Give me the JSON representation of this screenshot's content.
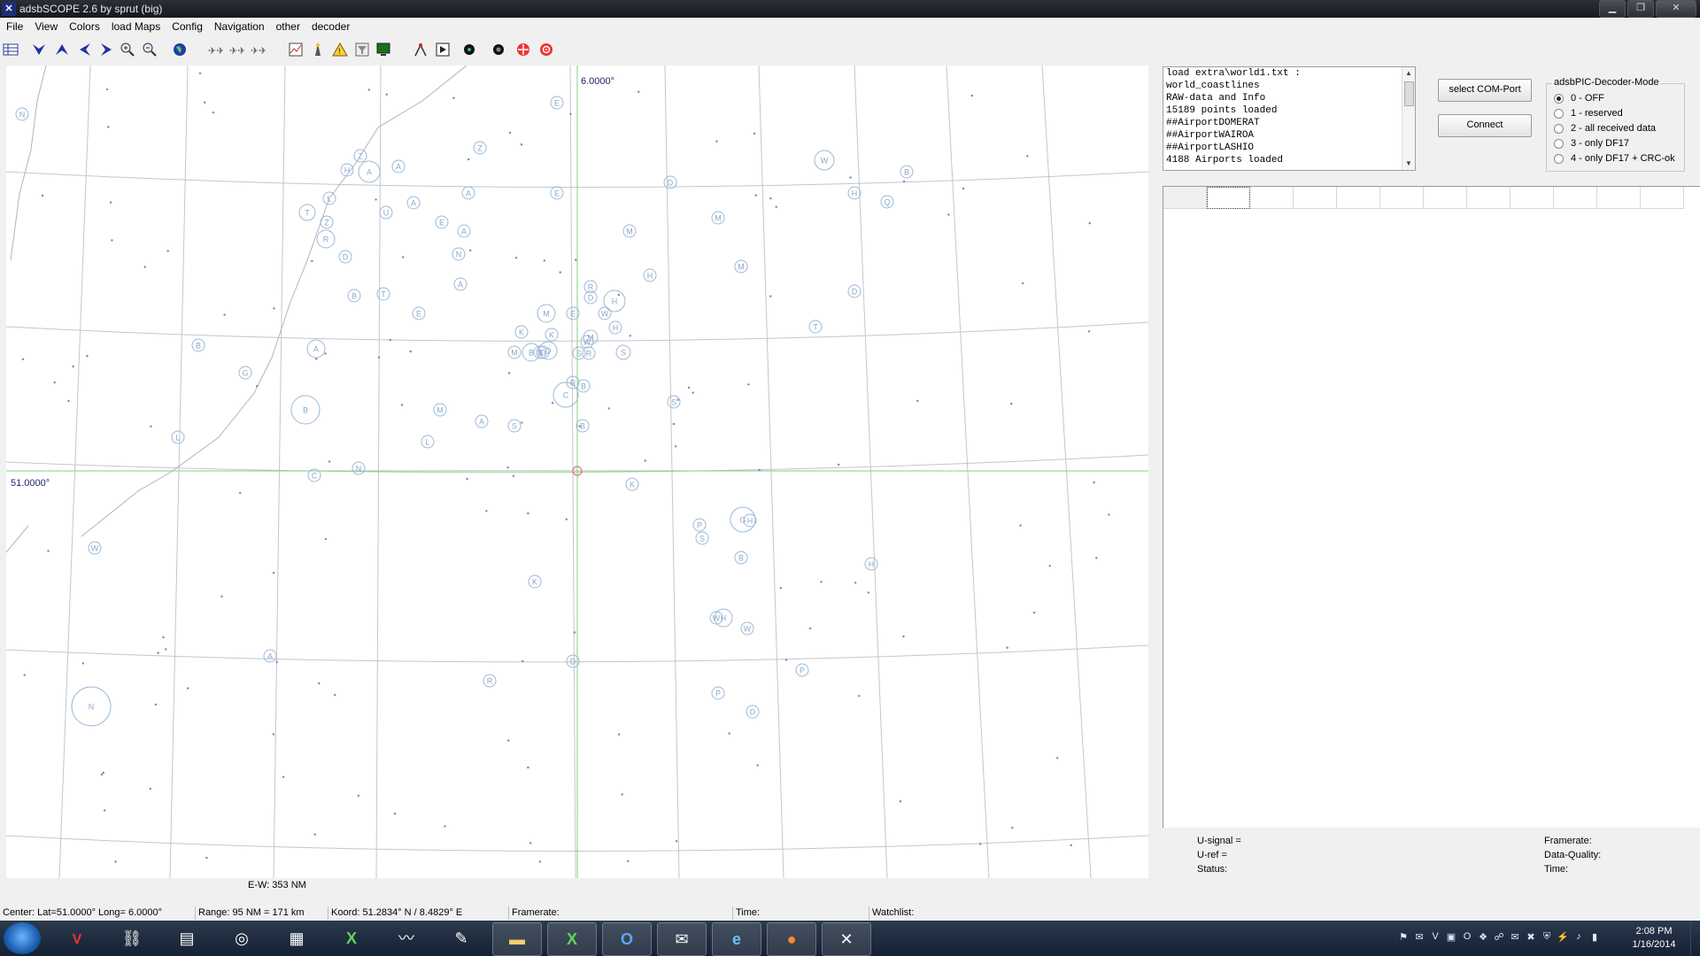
{
  "window": {
    "title": "adsbSCOPE 2.6 by sprut  (big)"
  },
  "menu": [
    "File",
    "View",
    "Colors",
    "load Maps",
    "Config",
    "Navigation",
    "other",
    "decoder"
  ],
  "toolbar_icons": [
    "table-icon",
    "arrow-down-icon",
    "arrow-up-icon",
    "arrow-left-icon",
    "arrow-right-icon",
    "zoom-in-icon",
    "zoom-out-icon",
    "globe-icon",
    "planes1-icon",
    "planes2-icon",
    "planes3-icon",
    "chart-icon",
    "tower-icon",
    "warning-icon",
    "filter-icon",
    "monitor-icon",
    "antenna-icon",
    "play-icon",
    "black-dot-icon",
    "record-icon",
    "crosshair-icon",
    "target-icon"
  ],
  "map": {
    "lon_label": "6.0000°",
    "lat_label": "51.0000°",
    "ew_label": "E-W: 353 NM",
    "airports": [
      "N",
      "Z",
      "H",
      "A",
      "A",
      "L",
      "T",
      "Z",
      "R",
      "U",
      "A",
      "E",
      "D",
      "B",
      "T",
      "E",
      "A",
      "B",
      "G",
      "B",
      "L",
      "C",
      "N",
      "A",
      "M",
      "L",
      "A",
      "E",
      "E",
      "Z",
      "A",
      "A",
      "N",
      "S",
      "M",
      "D",
      "B",
      "O",
      "N",
      "K",
      "M",
      "M",
      "E",
      "R",
      "H",
      "D",
      "W",
      "H",
      "K",
      "W",
      "R",
      "S",
      "C",
      "B",
      "B",
      "S",
      "K",
      "D",
      "M",
      "M",
      "W",
      "B",
      "H",
      "Q",
      "D",
      "T",
      "H",
      "S",
      "M",
      "R",
      "P",
      "G",
      "H",
      "S",
      "B",
      "K",
      "W",
      "W",
      "H",
      "D",
      "R",
      "A",
      "W",
      "P",
      "H",
      "P",
      "D"
    ]
  },
  "log_lines": [
    "load extra\\world1.txt :",
    "world_coastlines",
    "RAW-data and Info",
    "15189 points loaded",
    "##AirportDOMERAT",
    "##AirportWAIROA",
    "##AirportLASHIO",
    "4188 Airports loaded"
  ],
  "buttons": {
    "select_com": "select COM-Port",
    "connect": "Connect"
  },
  "decoder_mode": {
    "legend": "adsbPIC-Decoder-Mode",
    "options": [
      "0 - OFF",
      "1 - reserved",
      "2 - all received data",
      "3 - only DF17",
      "4 - only DF17 + CRC-ok"
    ],
    "selected": "0 - OFF"
  },
  "signal_panel": {
    "u_signal": "U-signal =",
    "u_ref": "U-ref =",
    "status": "Status:",
    "framerate": "Framerate:",
    "data_quality": "Data-Quality:",
    "time": "Time:"
  },
  "statusbar": {
    "center": "Center: Lat=51.0000° Long= 6.0000°",
    "range": "Range: 95 NM = 171 km",
    "koord": "Koord: 51.2834° N / 8.4829° E",
    "framerate": "Framerate:",
    "time": "Time:",
    "watchlist": "Watchlist:"
  },
  "taskbar": {
    "apps": [
      "vc-icon",
      "network-icon",
      "notepad-icon",
      "swirl-icon",
      "calculator-icon",
      "excel-icon",
      "dolphin-icon",
      "pen-icon",
      "folder-icon",
      "excel2-icon",
      "outlook-icon",
      "thunderbird-icon",
      "ie-icon",
      "firefox-icon",
      "adsbscope-icon"
    ],
    "clock_time": "2:08 PM",
    "clock_date": "1/16/2014"
  }
}
